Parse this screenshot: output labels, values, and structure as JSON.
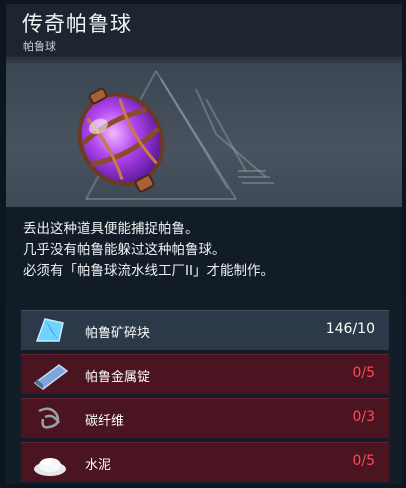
{
  "item": {
    "title": "传奇帕鲁球",
    "subtitle": "帕鲁球",
    "icon": "legendary-pal-sphere-icon"
  },
  "description": {
    "lines": [
      "丢出这种道具便能捕捉帕鲁。",
      "几乎没有帕鲁能躲过这种帕鲁球。",
      "必须有「帕鲁球流水线工厂II」才能制作。"
    ]
  },
  "materials": [
    {
      "name": "帕鲁矿碎块",
      "count": "146/10",
      "sufficient": true,
      "icon": "pal-fragment-icon"
    },
    {
      "name": "帕鲁金属锭",
      "count": "0/5",
      "sufficient": false,
      "icon": "pal-metal-ingot-icon"
    },
    {
      "name": "碳纤维",
      "count": "0/3",
      "sufficient": false,
      "icon": "carbon-fiber-icon"
    },
    {
      "name": "水泥",
      "count": "0/5",
      "sufficient": false,
      "icon": "cement-icon"
    }
  ],
  "colors": {
    "insufficient": "#ff4a58",
    "sufficient": "#ffffff",
    "missing_row_bg": "#4a1420"
  }
}
